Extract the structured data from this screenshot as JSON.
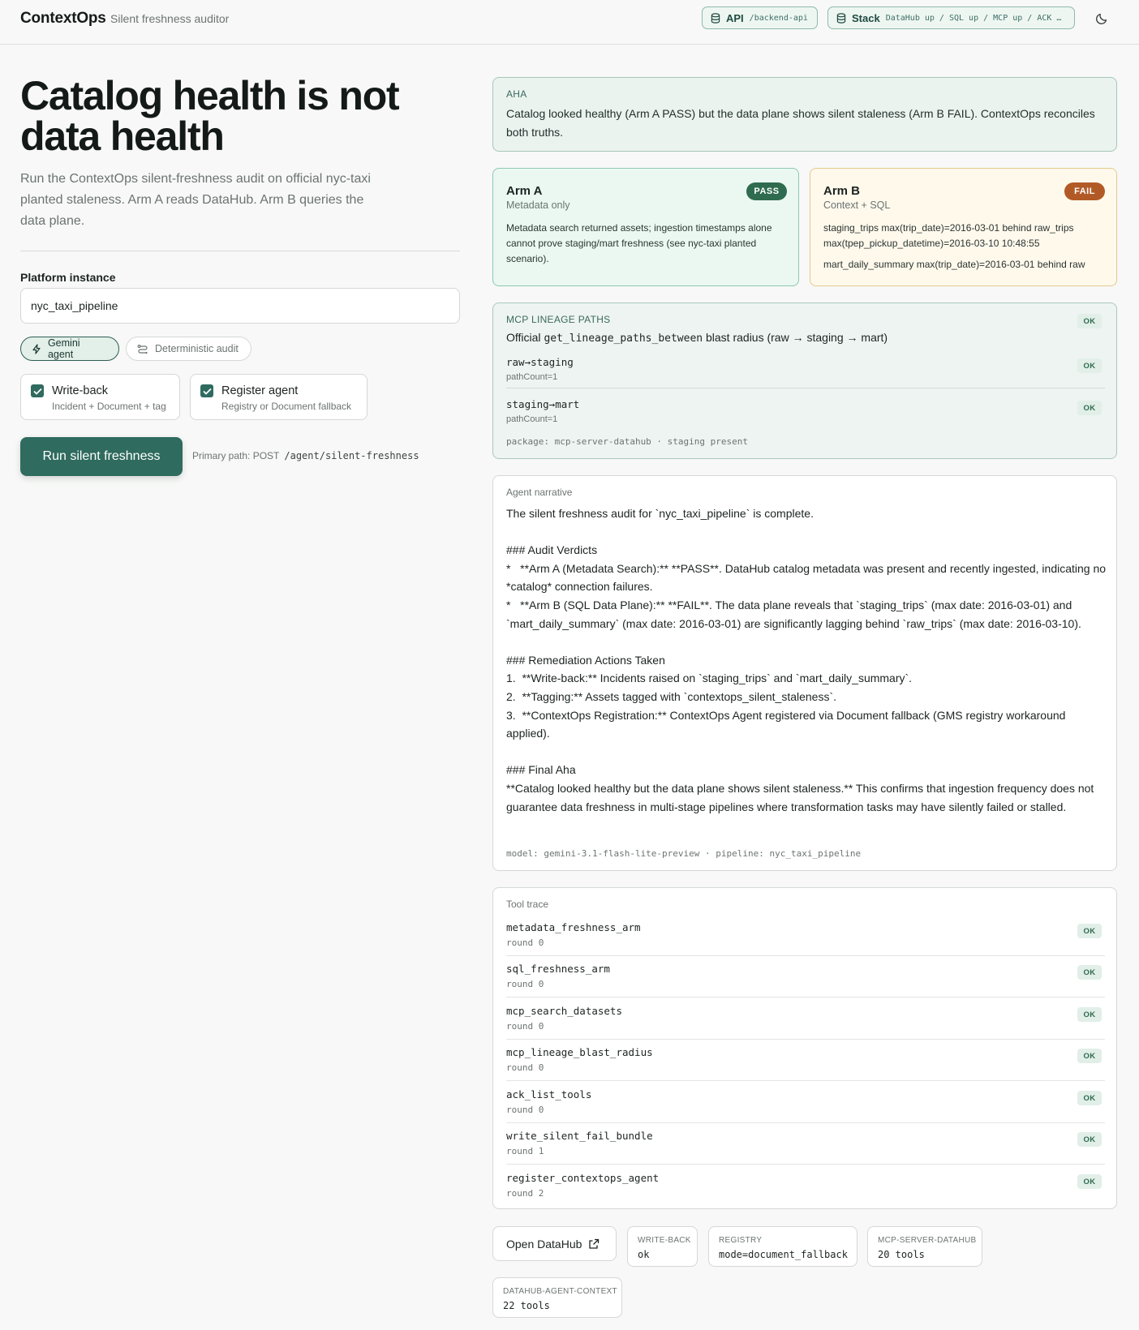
{
  "header": {
    "brand": "ContextOps",
    "subtitle": "Silent freshness auditor",
    "api_label": "API",
    "api_value": "/backend-api",
    "stack_label": "Stack",
    "stack_value": "DataHub up / SQL up / MCP up / ACK …"
  },
  "hero": {
    "title": "Catalog health is not data health",
    "lead": "Run the ContextOps silent-freshness audit on official nyc-taxi planted staleness. Arm A reads DataHub. Arm B queries the data plane."
  },
  "form": {
    "platform_label": "Platform instance",
    "platform_value": "nyc_taxi_pipeline",
    "mode_gemini": "Gemini agent",
    "mode_deterministic": "Deterministic audit",
    "writeback_title": "Write-back",
    "writeback_sub": "Incident + Document + tag",
    "register_title": "Register agent",
    "register_sub": "Registry or Document fallback",
    "run_label": "Run silent freshness",
    "primary_prefix": "Primary path: POST",
    "primary_path": "/agent/silent-freshness"
  },
  "aha": {
    "heading": "AHA",
    "body": "Catalog looked healthy (Arm A PASS) but the data plane shows silent staleness (Arm B FAIL). ContextOps reconciles both truths."
  },
  "arm_a": {
    "title": "Arm A",
    "subtitle": "Metadata only",
    "badge": "PASS",
    "text": "Metadata search returned assets; ingestion timestamps alone cannot prove staging/mart freshness (see nyc-taxi planted scenario)."
  },
  "arm_b": {
    "title": "Arm B",
    "subtitle": "Context + SQL",
    "badge": "FAIL",
    "line1": "staging_trips max(trip_date)=2016-03-01 behind raw_trips max(tpep_pickup_datetime)=2016-03-10 10:48:55",
    "line2": "mart_daily_summary max(trip_date)=2016-03-01 behind raw"
  },
  "lineage": {
    "heading": "MCP LINEAGE PATHS",
    "status": "OK",
    "sub_prefix": "Official",
    "sub_code": "get_lineage_paths_between",
    "sub_suffix": "blast radius (raw → staging → mart)",
    "rows": [
      {
        "name": "raw→staging",
        "count": "pathCount=1",
        "status": "OK"
      },
      {
        "name": "staging→mart",
        "count": "pathCount=1",
        "status": "OK"
      }
    ],
    "package": "package: mcp-server-datahub · staging present"
  },
  "narrative": {
    "heading": "Agent narrative",
    "body": "The silent freshness audit for `nyc_taxi_pipeline` is complete.\n\n### Audit Verdicts\n*   **Arm A (Metadata Search):** **PASS**. DataHub catalog metadata was present and recently ingested, indicating no *catalog* connection failures.\n*   **Arm B (SQL Data Plane):** **FAIL**. The data plane reveals that `staging_trips` (max date: 2016-03-01) and `mart_daily_summary` (max date: 2016-03-01) are significantly lagging behind `raw_trips` (max date: 2016-03-10).\n\n### Remediation Actions Taken\n1.  **Write-back:** Incidents raised on `staging_trips` and `mart_daily_summary`.\n2.  **Tagging:** Assets tagged with `contextops_silent_staleness`.\n3.  **ContextOps Registration:** ContextOps Agent registered via Document fallback (GMS registry workaround applied).\n\n### Final Aha\n**Catalog looked healthy but the data plane shows silent staleness.** This confirms that ingestion frequency does not guarantee data freshness in multi-stage pipelines where transformation tasks may have silently failed or stalled.",
    "footer": "model: gemini-3.1-flash-lite-preview · pipeline: nyc_taxi_pipeline"
  },
  "trace": {
    "heading": "Tool trace",
    "rows": [
      {
        "name": "metadata_freshness_arm",
        "round": "round 0",
        "status": "OK"
      },
      {
        "name": "sql_freshness_arm",
        "round": "round 0",
        "status": "OK"
      },
      {
        "name": "mcp_search_datasets",
        "round": "round 0",
        "status": "OK"
      },
      {
        "name": "mcp_lineage_blast_radius",
        "round": "round 0",
        "status": "OK"
      },
      {
        "name": "ack_list_tools",
        "round": "round 0",
        "status": "OK"
      },
      {
        "name": "write_silent_fail_bundle",
        "round": "round 1",
        "status": "OK"
      },
      {
        "name": "register_contextops_agent",
        "round": "round 2",
        "status": "OK"
      }
    ]
  },
  "footer": {
    "open_datahub": "Open DataHub",
    "tiles": [
      {
        "key": "WRITE-BACK",
        "value": "ok"
      },
      {
        "key": "REGISTRY",
        "value": "mode=document_fallback"
      },
      {
        "key": "MCP-SERVER-DATAHUB",
        "value": "20 tools"
      },
      {
        "key": "DATAHUB-AGENT-CONTEXT",
        "value": "22 tools"
      }
    ]
  }
}
